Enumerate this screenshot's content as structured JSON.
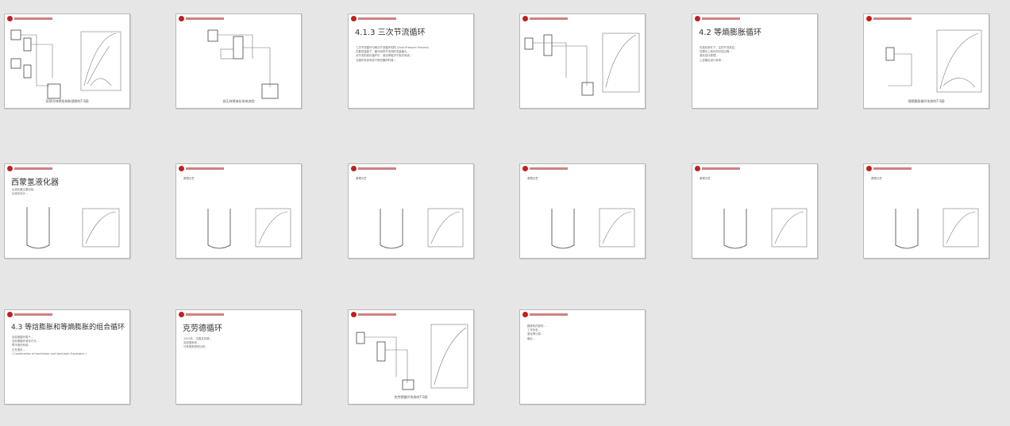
{
  "slides": [
    {
      "caption": "双预冷林德系统和理想的T-S图"
    },
    {
      "caption": "双压林德液化系统流程"
    },
    {
      "title": "4.1.3 三次节流循环",
      "bullets": [
        "三次节流循环与两次节流循环相同 (Dual-Pressure Process)",
        "在最低温度下，最冷段的节流阀的流量最大...",
        "对节流的液化循环中，液化率取决于制冷系统...",
        "当循环系统有若干换热器的时候..."
      ]
    },
    {
      "caption": ""
    },
    {
      "title": "4.2 等熵膨胀循环",
      "bullets": [
        "在液化条件下，氢的节流效应...",
        "在理论上液化的可逆过程...",
        "液化设计原理...",
        "上述最后设计参考..."
      ]
    },
    {
      "caption": "理想膨胀循环系统的T-S图"
    },
    {
      "title": "西蒙氢液化器",
      "bullets": [
        "氢液化器主要包括...",
        "氢液化设计..."
      ]
    },
    {
      "label": "原理示意"
    },
    {
      "label": "原理示意"
    },
    {
      "label": "原理示意"
    },
    {
      "label": "原理示意"
    },
    {
      "label": "原理示意"
    },
    {
      "title": "4.3 等焓膨胀和等熵膨胀的组合循环",
      "bullets": [
        "克劳德循环属于...",
        "克劳德循环液化方式...",
        "预冷液化系统...",
        "正在液化..."
      ],
      "footer": "( Combination of Isenthalpic and Isentropic Expansion )"
    },
    {
      "title": "克劳德循环",
      "bullets": [
        "1902年，法国克劳德...",
        "克劳德系统...",
        "与林德系统的比较..."
      ]
    },
    {
      "caption": "克劳德循环系统的T-S图"
    },
    {
      "bullets": [
        "膨胀机内部的...",
        "工作状态...",
        "液化率计算...",
        "最后..."
      ]
    }
  ]
}
